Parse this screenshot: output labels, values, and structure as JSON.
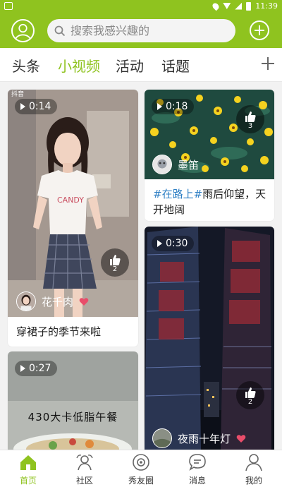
{
  "status_bar": {
    "time": "11:39",
    "icons": [
      "notification-icon",
      "location-icon",
      "wifi-icon",
      "signal-icon",
      "battery-icon"
    ]
  },
  "header": {
    "search_placeholder": "搜索我感兴趣的"
  },
  "tabs": [
    {
      "label": "头条",
      "active": false
    },
    {
      "label": "小视频",
      "active": true
    },
    {
      "label": "活动",
      "active": false
    },
    {
      "label": "话题",
      "active": false
    }
  ],
  "cards": [
    {
      "duration": "0:14",
      "likes": "2",
      "author": "花千肉",
      "caption": "穿裙子的季节来啦",
      "watermark": "抖音"
    },
    {
      "duration": "0:18",
      "likes": "3",
      "author": "墨笛",
      "caption_tag": "#在路上#",
      "caption_line1": "雨后仰望，天",
      "caption_line2": "开地阔"
    },
    {
      "duration": "0:27",
      "overlay_text": "430大卡低脂午餐"
    },
    {
      "duration": "0:30",
      "likes": "2",
      "author": "夜雨十年灯"
    }
  ],
  "bottom_nav": [
    {
      "label": "首页",
      "icon": "home-icon",
      "active": true
    },
    {
      "label": "社区",
      "icon": "community-icon",
      "active": false
    },
    {
      "label": "秀友圈",
      "icon": "friends-circle-icon",
      "active": false
    },
    {
      "label": "消息",
      "icon": "message-icon",
      "active": false
    },
    {
      "label": "我的",
      "icon": "profile-icon",
      "active": false
    }
  ],
  "colors": {
    "brand_green": "#8fc31f",
    "hashtag_blue": "#2e7fc4",
    "heart_red": "#e94d6a"
  }
}
